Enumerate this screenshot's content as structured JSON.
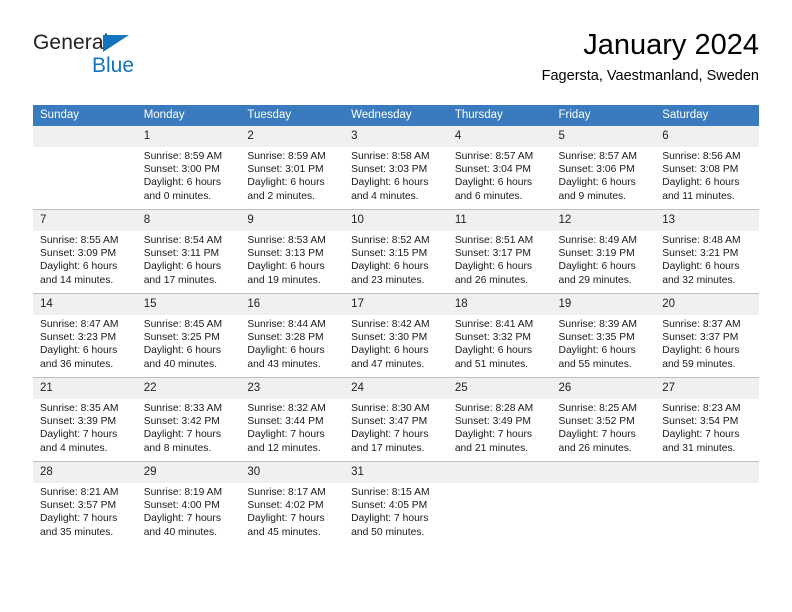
{
  "brand": {
    "line1": "General",
    "line2": "Blue",
    "triangle_color": "#1274bf"
  },
  "header": {
    "title": "January 2024",
    "subtitle": "Fagersta, Vaestmanland, Sweden"
  },
  "theme": {
    "header_bg": "#3a7bbf",
    "header_text": "#ffffff",
    "daynum_bg": "#f0f0f0",
    "grid_line": "#bfbfbf",
    "cell_bg": "#ffffff"
  },
  "weekday_headers": [
    "Sunday",
    "Monday",
    "Tuesday",
    "Wednesday",
    "Thursday",
    "Friday",
    "Saturday"
  ],
  "weeks": [
    [
      {
        "day": "",
        "blank": true,
        "sunrise": "",
        "sunset": "",
        "daylight_line1": "",
        "daylight_line2": ""
      },
      {
        "day": "1",
        "blank": false,
        "sunrise": "Sunrise: 8:59 AM",
        "sunset": "Sunset: 3:00 PM",
        "daylight_line1": "Daylight: 6 hours",
        "daylight_line2": "and 0 minutes."
      },
      {
        "day": "2",
        "blank": false,
        "sunrise": "Sunrise: 8:59 AM",
        "sunset": "Sunset: 3:01 PM",
        "daylight_line1": "Daylight: 6 hours",
        "daylight_line2": "and 2 minutes."
      },
      {
        "day": "3",
        "blank": false,
        "sunrise": "Sunrise: 8:58 AM",
        "sunset": "Sunset: 3:03 PM",
        "daylight_line1": "Daylight: 6 hours",
        "daylight_line2": "and 4 minutes."
      },
      {
        "day": "4",
        "blank": false,
        "sunrise": "Sunrise: 8:57 AM",
        "sunset": "Sunset: 3:04 PM",
        "daylight_line1": "Daylight: 6 hours",
        "daylight_line2": "and 6 minutes."
      },
      {
        "day": "5",
        "blank": false,
        "sunrise": "Sunrise: 8:57 AM",
        "sunset": "Sunset: 3:06 PM",
        "daylight_line1": "Daylight: 6 hours",
        "daylight_line2": "and 9 minutes."
      },
      {
        "day": "6",
        "blank": false,
        "sunrise": "Sunrise: 8:56 AM",
        "sunset": "Sunset: 3:08 PM",
        "daylight_line1": "Daylight: 6 hours",
        "daylight_line2": "and 11 minutes."
      }
    ],
    [
      {
        "day": "7",
        "blank": false,
        "sunrise": "Sunrise: 8:55 AM",
        "sunset": "Sunset: 3:09 PM",
        "daylight_line1": "Daylight: 6 hours",
        "daylight_line2": "and 14 minutes."
      },
      {
        "day": "8",
        "blank": false,
        "sunrise": "Sunrise: 8:54 AM",
        "sunset": "Sunset: 3:11 PM",
        "daylight_line1": "Daylight: 6 hours",
        "daylight_line2": "and 17 minutes."
      },
      {
        "day": "9",
        "blank": false,
        "sunrise": "Sunrise: 8:53 AM",
        "sunset": "Sunset: 3:13 PM",
        "daylight_line1": "Daylight: 6 hours",
        "daylight_line2": "and 19 minutes."
      },
      {
        "day": "10",
        "blank": false,
        "sunrise": "Sunrise: 8:52 AM",
        "sunset": "Sunset: 3:15 PM",
        "daylight_line1": "Daylight: 6 hours",
        "daylight_line2": "and 23 minutes."
      },
      {
        "day": "11",
        "blank": false,
        "sunrise": "Sunrise: 8:51 AM",
        "sunset": "Sunset: 3:17 PM",
        "daylight_line1": "Daylight: 6 hours",
        "daylight_line2": "and 26 minutes."
      },
      {
        "day": "12",
        "blank": false,
        "sunrise": "Sunrise: 8:49 AM",
        "sunset": "Sunset: 3:19 PM",
        "daylight_line1": "Daylight: 6 hours",
        "daylight_line2": "and 29 minutes."
      },
      {
        "day": "13",
        "blank": false,
        "sunrise": "Sunrise: 8:48 AM",
        "sunset": "Sunset: 3:21 PM",
        "daylight_line1": "Daylight: 6 hours",
        "daylight_line2": "and 32 minutes."
      }
    ],
    [
      {
        "day": "14",
        "blank": false,
        "sunrise": "Sunrise: 8:47 AM",
        "sunset": "Sunset: 3:23 PM",
        "daylight_line1": "Daylight: 6 hours",
        "daylight_line2": "and 36 minutes."
      },
      {
        "day": "15",
        "blank": false,
        "sunrise": "Sunrise: 8:45 AM",
        "sunset": "Sunset: 3:25 PM",
        "daylight_line1": "Daylight: 6 hours",
        "daylight_line2": "and 40 minutes."
      },
      {
        "day": "16",
        "blank": false,
        "sunrise": "Sunrise: 8:44 AM",
        "sunset": "Sunset: 3:28 PM",
        "daylight_line1": "Daylight: 6 hours",
        "daylight_line2": "and 43 minutes."
      },
      {
        "day": "17",
        "blank": false,
        "sunrise": "Sunrise: 8:42 AM",
        "sunset": "Sunset: 3:30 PM",
        "daylight_line1": "Daylight: 6 hours",
        "daylight_line2": "and 47 minutes."
      },
      {
        "day": "18",
        "blank": false,
        "sunrise": "Sunrise: 8:41 AM",
        "sunset": "Sunset: 3:32 PM",
        "daylight_line1": "Daylight: 6 hours",
        "daylight_line2": "and 51 minutes."
      },
      {
        "day": "19",
        "blank": false,
        "sunrise": "Sunrise: 8:39 AM",
        "sunset": "Sunset: 3:35 PM",
        "daylight_line1": "Daylight: 6 hours",
        "daylight_line2": "and 55 minutes."
      },
      {
        "day": "20",
        "blank": false,
        "sunrise": "Sunrise: 8:37 AM",
        "sunset": "Sunset: 3:37 PM",
        "daylight_line1": "Daylight: 6 hours",
        "daylight_line2": "and 59 minutes."
      }
    ],
    [
      {
        "day": "21",
        "blank": false,
        "sunrise": "Sunrise: 8:35 AM",
        "sunset": "Sunset: 3:39 PM",
        "daylight_line1": "Daylight: 7 hours",
        "daylight_line2": "and 4 minutes."
      },
      {
        "day": "22",
        "blank": false,
        "sunrise": "Sunrise: 8:33 AM",
        "sunset": "Sunset: 3:42 PM",
        "daylight_line1": "Daylight: 7 hours",
        "daylight_line2": "and 8 minutes."
      },
      {
        "day": "23",
        "blank": false,
        "sunrise": "Sunrise: 8:32 AM",
        "sunset": "Sunset: 3:44 PM",
        "daylight_line1": "Daylight: 7 hours",
        "daylight_line2": "and 12 minutes."
      },
      {
        "day": "24",
        "blank": false,
        "sunrise": "Sunrise: 8:30 AM",
        "sunset": "Sunset: 3:47 PM",
        "daylight_line1": "Daylight: 7 hours",
        "daylight_line2": "and 17 minutes."
      },
      {
        "day": "25",
        "blank": false,
        "sunrise": "Sunrise: 8:28 AM",
        "sunset": "Sunset: 3:49 PM",
        "daylight_line1": "Daylight: 7 hours",
        "daylight_line2": "and 21 minutes."
      },
      {
        "day": "26",
        "blank": false,
        "sunrise": "Sunrise: 8:25 AM",
        "sunset": "Sunset: 3:52 PM",
        "daylight_line1": "Daylight: 7 hours",
        "daylight_line2": "and 26 minutes."
      },
      {
        "day": "27",
        "blank": false,
        "sunrise": "Sunrise: 8:23 AM",
        "sunset": "Sunset: 3:54 PM",
        "daylight_line1": "Daylight: 7 hours",
        "daylight_line2": "and 31 minutes."
      }
    ],
    [
      {
        "day": "28",
        "blank": false,
        "sunrise": "Sunrise: 8:21 AM",
        "sunset": "Sunset: 3:57 PM",
        "daylight_line1": "Daylight: 7 hours",
        "daylight_line2": "and 35 minutes."
      },
      {
        "day": "29",
        "blank": false,
        "sunrise": "Sunrise: 8:19 AM",
        "sunset": "Sunset: 4:00 PM",
        "daylight_line1": "Daylight: 7 hours",
        "daylight_line2": "and 40 minutes."
      },
      {
        "day": "30",
        "blank": false,
        "sunrise": "Sunrise: 8:17 AM",
        "sunset": "Sunset: 4:02 PM",
        "daylight_line1": "Daylight: 7 hours",
        "daylight_line2": "and 45 minutes."
      },
      {
        "day": "31",
        "blank": false,
        "sunrise": "Sunrise: 8:15 AM",
        "sunset": "Sunset: 4:05 PM",
        "daylight_line1": "Daylight: 7 hours",
        "daylight_line2": "and 50 minutes."
      },
      {
        "day": "",
        "blank": true,
        "sunrise": "",
        "sunset": "",
        "daylight_line1": "",
        "daylight_line2": ""
      },
      {
        "day": "",
        "blank": true,
        "sunrise": "",
        "sunset": "",
        "daylight_line1": "",
        "daylight_line2": ""
      },
      {
        "day": "",
        "blank": true,
        "sunrise": "",
        "sunset": "",
        "daylight_line1": "",
        "daylight_line2": ""
      }
    ]
  ]
}
